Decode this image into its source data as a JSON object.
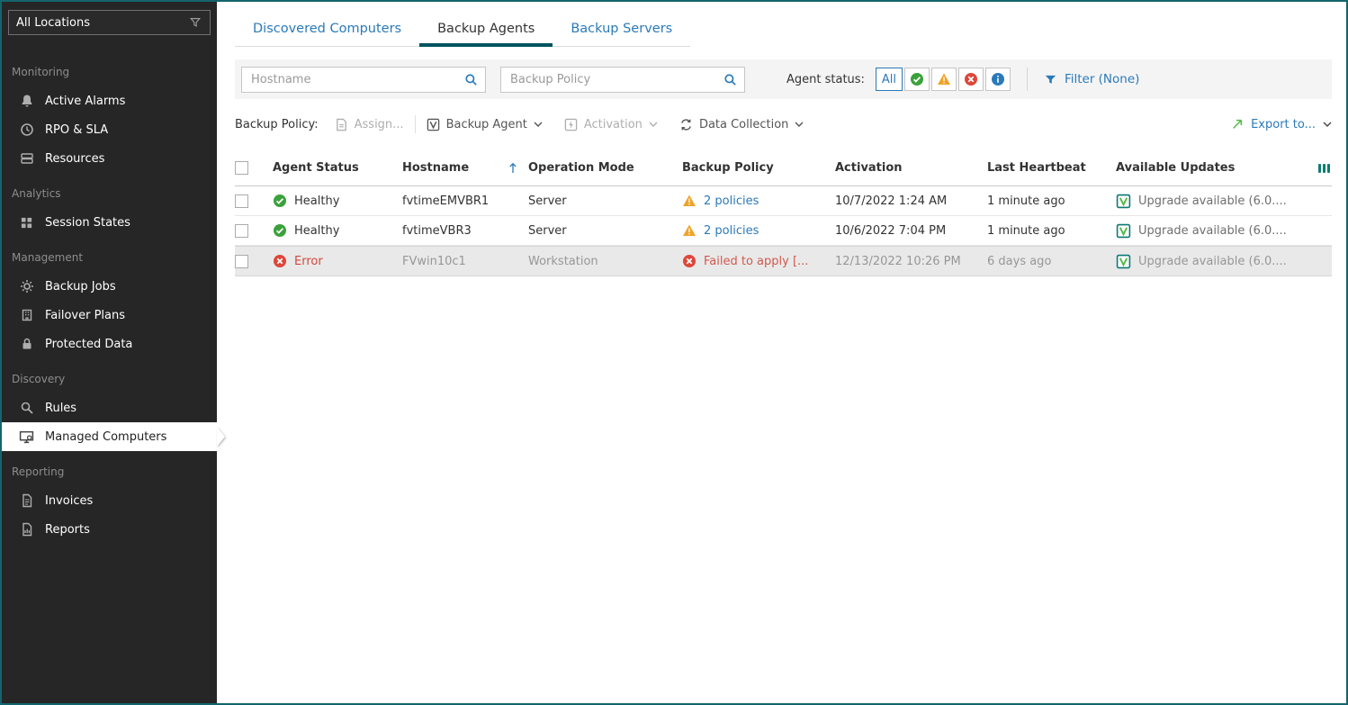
{
  "sidebar": {
    "location_selector": {
      "label": "All Locations",
      "icon": "filter-funnel-icon"
    },
    "sections": [
      {
        "title": "Monitoring",
        "items": [
          {
            "label": "Active Alarms",
            "icon": "bell-icon"
          },
          {
            "label": "RPO & SLA",
            "icon": "clock-icon"
          },
          {
            "label": "Resources",
            "icon": "resources-icon"
          }
        ]
      },
      {
        "title": "Analytics",
        "items": [
          {
            "label": "Session States",
            "icon": "grid-icon"
          }
        ]
      },
      {
        "title": "Management",
        "items": [
          {
            "label": "Backup Jobs",
            "icon": "gear-icon"
          },
          {
            "label": "Failover Plans",
            "icon": "building-icon"
          },
          {
            "label": "Protected Data",
            "icon": "lock-icon"
          }
        ]
      },
      {
        "title": "Discovery",
        "items": [
          {
            "label": "Rules",
            "icon": "magnifier-icon"
          },
          {
            "label": "Managed Computers",
            "icon": "computer-icon",
            "selected": true
          }
        ]
      },
      {
        "title": "Reporting",
        "items": [
          {
            "label": "Invoices",
            "icon": "invoice-icon"
          },
          {
            "label": "Reports",
            "icon": "report-icon"
          }
        ]
      }
    ]
  },
  "tabs": [
    {
      "label": "Discovered Computers",
      "active": false
    },
    {
      "label": "Backup Agents",
      "active": true
    },
    {
      "label": "Backup Servers",
      "active": false
    }
  ],
  "filter_bar": {
    "hostname_placeholder": "Hostname",
    "backup_policy_placeholder": "Backup Policy",
    "agent_status_label": "Agent status:",
    "status_all_label": "All",
    "filter_label": "Filter (None)"
  },
  "toolbar": {
    "backup_policy_label": "Backup Policy:",
    "assign_label": "Assign...",
    "backup_agent_label": "Backup Agent",
    "activation_label": "Activation",
    "data_collection_label": "Data Collection",
    "export_label": "Export to..."
  },
  "table": {
    "headers": {
      "agent_status": "Agent Status",
      "hostname": "Hostname",
      "operation_mode": "Operation Mode",
      "backup_policy": "Backup Policy",
      "activation": "Activation",
      "last_heartbeat": "Last Heartbeat",
      "available_updates": "Available Updates"
    },
    "rows": [
      {
        "agent_status": "Healthy",
        "status_icon": "healthy-icon",
        "hostname": "fvtimeEMVBR1",
        "operation_mode": "Server",
        "backup_policy": "2 policies",
        "backup_policy_icon": "warning-icon",
        "activation": "10/7/2022 1:24 AM",
        "last_heartbeat": "1 minute ago",
        "available_updates": "Upgrade available (6.0....",
        "selected": false
      },
      {
        "agent_status": "Healthy",
        "status_icon": "healthy-icon",
        "hostname": "fvtimeVBR3",
        "operation_mode": "Server",
        "backup_policy": "2 policies",
        "backup_policy_icon": "warning-icon",
        "activation": "10/6/2022 7:04 PM",
        "last_heartbeat": "1 minute ago",
        "available_updates": "Upgrade available (6.0....",
        "selected": false
      },
      {
        "agent_status": "Error",
        "status_icon": "error-icon",
        "hostname": "FVwin10c1",
        "operation_mode": "Workstation",
        "backup_policy": "Failed to apply [...",
        "backup_policy_icon": "error-icon",
        "activation": "12/13/2022 10:26 PM",
        "last_heartbeat": "6 days ago",
        "available_updates": "Upgrade available (6.0....",
        "selected": true
      }
    ]
  },
  "colors": {
    "accent_blue": "#2a7ab9",
    "accent_green": "#54b948",
    "error_red": "#de4639",
    "warning_orange": "#f0a32a",
    "active_tab_underline": "#00545f",
    "sidebar_bg": "#262626",
    "selected_row_bg": "#e9e9e9",
    "window_border": "#13646e"
  }
}
